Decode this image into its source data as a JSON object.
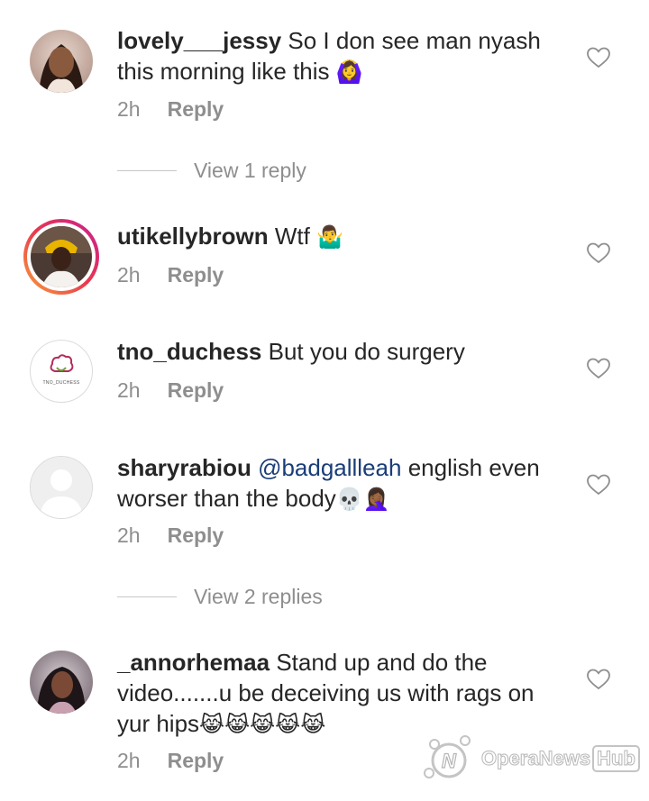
{
  "comments": [
    {
      "username": "lovely___jessy",
      "text": "So I don see man nyash this morning like this",
      "emoji": "🙆‍♀️",
      "time": "2h",
      "reply_label": "Reply",
      "view_replies": "View 1 reply"
    },
    {
      "username": "utikellybrown",
      "text": "Wtf",
      "emoji": "🤷‍♂️",
      "time": "2h",
      "reply_label": "Reply"
    },
    {
      "username": "tno_duchess",
      "text": "But you do surgery",
      "time": "2h",
      "reply_label": "Reply",
      "avatar_text": "TNO_DUCHESS"
    },
    {
      "username": "sharyrabiou",
      "mention": "@badgallleah",
      "text": "english even worser than the body",
      "emoji": "💀🤦🏾‍♀️",
      "time": "2h",
      "reply_label": "Reply",
      "view_replies": "View 2 replies"
    },
    {
      "username": "_annorhemaa",
      "text": "Stand up and do the video.......u be deceiving us with rags on yur hips",
      "emoji": "😹😹😹😹😹",
      "time": "2h",
      "reply_label": "Reply"
    }
  ],
  "watermark": {
    "text": "OperaNews",
    "hub": "Hub"
  },
  "colors": {
    "text": "#262626",
    "meta": "#8e8e8e",
    "mention": "#1a3d78",
    "story_ring_start": "#f9a13a",
    "story_ring_end": "#c91f8f"
  }
}
